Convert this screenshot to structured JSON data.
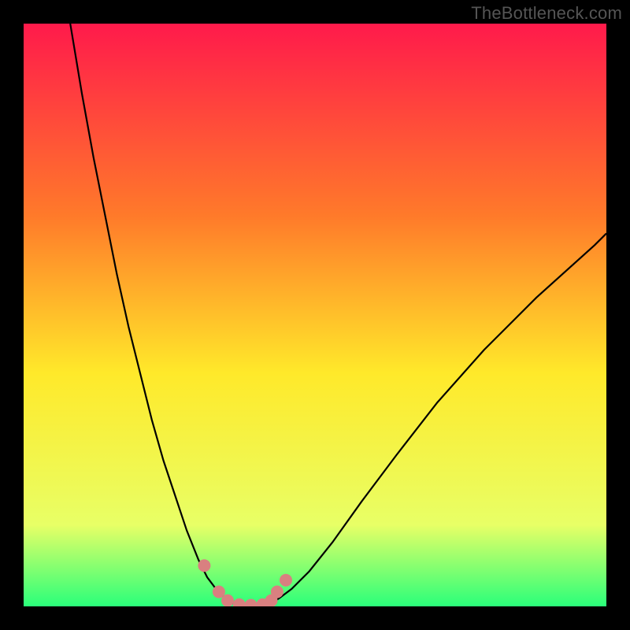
{
  "watermark": "TheBottleneck.com",
  "chart_data": {
    "type": "line",
    "title": "",
    "xlabel": "",
    "ylabel": "",
    "xlim": [
      0,
      100
    ],
    "ylim": [
      0,
      100
    ],
    "gradient_colors": {
      "top": "#ff1a4b",
      "mid_upper": "#ff7a2a",
      "mid": "#ffe92a",
      "lower": "#e8ff66",
      "bottom": "#2aff7a"
    },
    "series": [
      {
        "name": "bottleneck-curve-left",
        "x": [
          8,
          10,
          12,
          14,
          16,
          18,
          20,
          22,
          24,
          26,
          28,
          30,
          31.5,
          33,
          34.5,
          36,
          37
        ],
        "y": [
          100,
          88,
          77,
          67,
          57,
          48,
          40,
          32,
          25,
          19,
          13,
          8,
          5,
          3,
          1.5,
          0.5,
          0
        ]
      },
      {
        "name": "bottleneck-curve-right",
        "x": [
          41,
          42.5,
          44,
          46,
          49,
          53,
          58,
          64,
          71,
          79,
          88,
          98,
          100
        ],
        "y": [
          0,
          0.5,
          1.5,
          3,
          6,
          11,
          18,
          26,
          35,
          44,
          53,
          62,
          64
        ]
      }
    ],
    "flat_segment": {
      "x_start": 37,
      "x_end": 41,
      "y": 0
    },
    "markers": {
      "name": "highlight-dots",
      "color": "#d98080",
      "points": [
        {
          "x": 31.0,
          "y": 7.0
        },
        {
          "x": 33.5,
          "y": 2.5
        },
        {
          "x": 35.0,
          "y": 1.0
        },
        {
          "x": 37.0,
          "y": 0.3
        },
        {
          "x": 39.0,
          "y": 0.2
        },
        {
          "x": 41.0,
          "y": 0.3
        },
        {
          "x": 42.5,
          "y": 1.0
        },
        {
          "x": 43.5,
          "y": 2.5
        },
        {
          "x": 45.0,
          "y": 4.5
        }
      ]
    }
  }
}
